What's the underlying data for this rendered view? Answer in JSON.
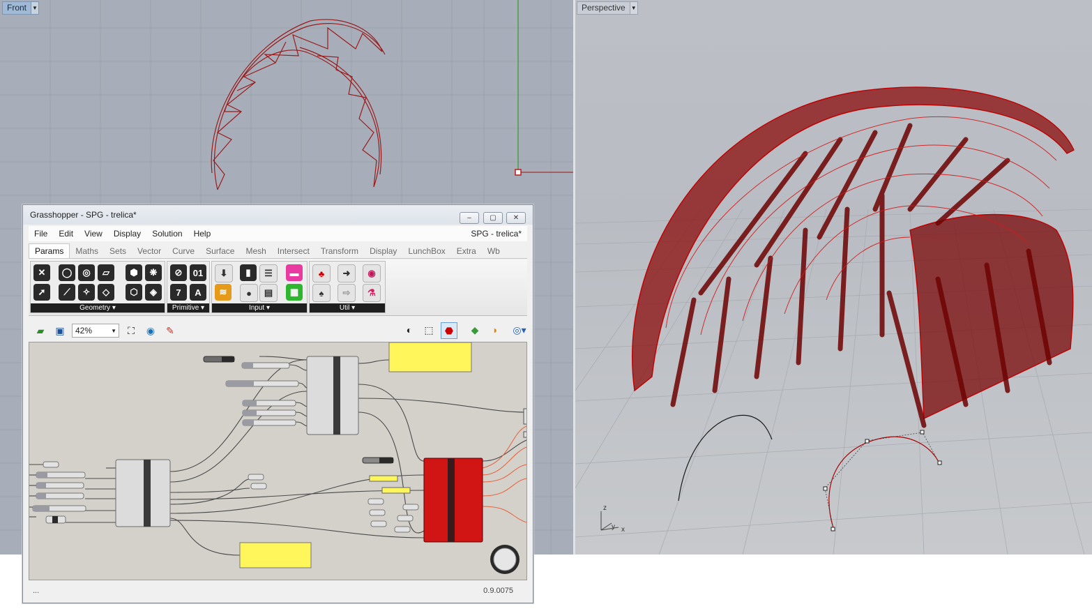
{
  "front_viewport": {
    "label": "Front",
    "dropdown_icon": "chevron-down-icon",
    "background": "#a7aeb9",
    "geometry_color": "#9a1b1b"
  },
  "perspective_viewport": {
    "label": "Perspective",
    "dropdown_icon": "chevron-down-icon",
    "axis_labels": {
      "z": "z",
      "y": "y",
      "x": "x"
    },
    "geometry_color": "#8b0b0b"
  },
  "grasshopper": {
    "title": "Grasshopper - SPG - trelica*",
    "window_buttons": {
      "minimize": "–",
      "maximize": "▢",
      "close": "✕"
    },
    "menu": [
      "File",
      "Edit",
      "View",
      "Display",
      "Solution",
      "Help"
    ],
    "document_name": "SPG - trelica*",
    "tabs": [
      "Params",
      "Maths",
      "Sets",
      "Vector",
      "Curve",
      "Surface",
      "Mesh",
      "Intersect",
      "Transform",
      "Display",
      "LunchBox",
      "Extra",
      "Wb"
    ],
    "active_tab": "Params",
    "panels": [
      {
        "name": "Geometry"
      },
      {
        "name": "Primitive"
      },
      {
        "name": "Input"
      },
      {
        "name": "Util"
      }
    ],
    "panel_expand_icon": "▾",
    "zoom_level": "42%",
    "version": "0.9.0075",
    "status_left": "...",
    "colors": {
      "canvas": "#d4d1cb",
      "panel_note": "#fff65c",
      "active_component": "#d11414"
    }
  }
}
